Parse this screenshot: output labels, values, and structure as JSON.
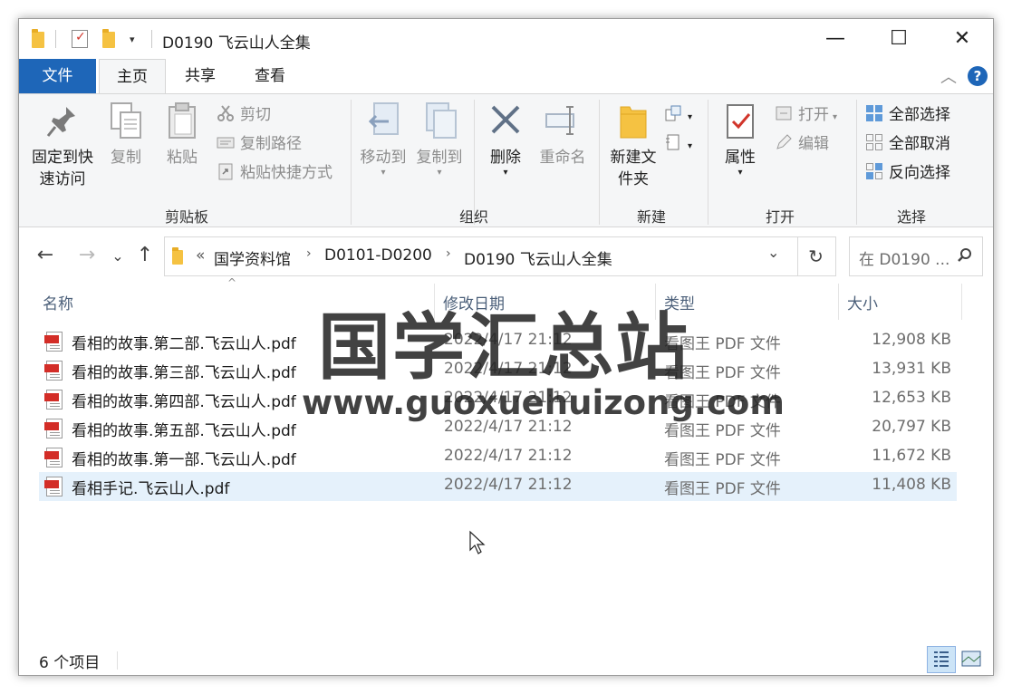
{
  "window": {
    "title": "D0190 飞云山人全集",
    "minimize": "—",
    "maximize": "☐",
    "close": "✕"
  },
  "menu": {
    "file": "文件",
    "home": "主页",
    "share": "共享",
    "view": "查看",
    "collapse": "︿",
    "help": "?"
  },
  "ribbon": {
    "clipboard": {
      "label": "剪贴板",
      "pin": "固定到快速访问",
      "copy": "复制",
      "paste": "粘贴",
      "cut": "剪切",
      "copy_path": "复制路径",
      "paste_shortcut": "粘贴快捷方式"
    },
    "organize": {
      "label": "组织",
      "move_to": "移动到",
      "copy_to": "复制到",
      "delete": "删除",
      "rename": "重命名"
    },
    "new": {
      "label": "新建",
      "new_folder": "新建文件夹"
    },
    "open": {
      "label": "打开",
      "properties": "属性",
      "open": "打开",
      "edit": "编辑"
    },
    "select": {
      "label": "选择",
      "select_all": "全部选择",
      "select_none": "全部取消",
      "invert": "反向选择"
    }
  },
  "nav": {
    "back": "←",
    "forward": "→",
    "recent": "⌄",
    "up": "↑",
    "overflow": "«",
    "breadcrumb": [
      "国学资料馆",
      "D0101-D0200",
      "D0190 飞云山人全集"
    ],
    "refresh": "↻",
    "search_placeholder": "在 D0190 ..."
  },
  "columns": {
    "name": "名称",
    "date": "修改日期",
    "type": "类型",
    "size": "大小"
  },
  "files": [
    {
      "name": "看相的故事.第二部.飞云山人.pdf",
      "date": "2022/4/17 21:12",
      "type": "看图王 PDF 文件",
      "size": "12,908 KB"
    },
    {
      "name": "看相的故事.第三部.飞云山人.pdf",
      "date": "2022/4/17 21:12",
      "type": "看图王 PDF 文件",
      "size": "13,931 KB"
    },
    {
      "name": "看相的故事.第四部.飞云山人.pdf",
      "date": "2022/4/17 21:12",
      "type": "看图王 PDF 文件",
      "size": "12,653 KB"
    },
    {
      "name": "看相的故事.第五部.飞云山人.pdf",
      "date": "2022/4/17 21:12",
      "type": "看图王 PDF 文件",
      "size": "20,797 KB"
    },
    {
      "name": "看相的故事.第一部.飞云山人.pdf",
      "date": "2022/4/17 21:12",
      "type": "看图王 PDF 文件",
      "size": "11,672 KB"
    },
    {
      "name": "看相手记.飞云山人.pdf",
      "date": "2022/4/17 21:12",
      "type": "看图王 PDF 文件",
      "size": "11,408 KB"
    }
  ],
  "selected_index": 5,
  "watermark": {
    "title": "国学汇总站",
    "url": "www.guoxuehuizong.com"
  },
  "status": {
    "count": "6 个项目"
  },
  "colors": {
    "accent": "#1e66b8",
    "selection": "#e5f1fb",
    "pdf_red": "#d32d27"
  }
}
